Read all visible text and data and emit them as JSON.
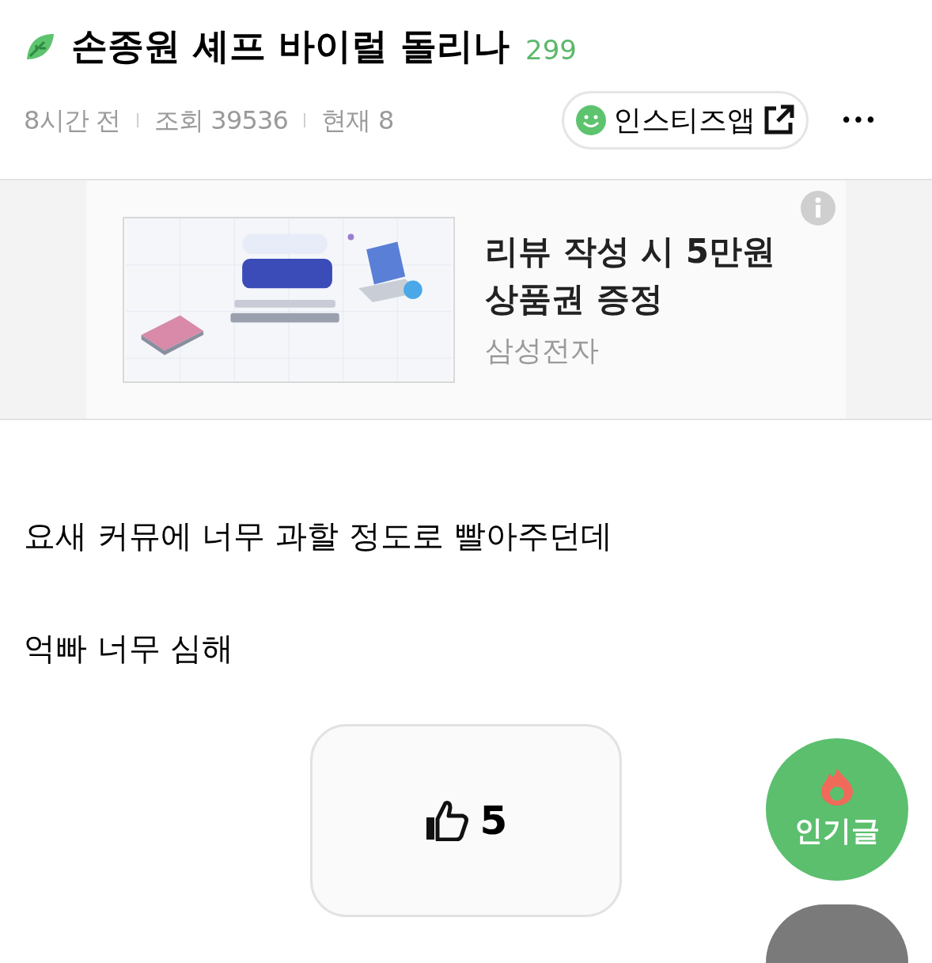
{
  "post": {
    "title": "손종원 셰프 바이럴 돌리나",
    "comment_count": "299",
    "meta": [
      "8시간 전",
      "조회 39536",
      "현재 8"
    ],
    "app_button": "인스티즈앱",
    "more": "•••"
  },
  "ad": {
    "kind": "picture",
    "headline": "리뷰 작성 시 5만원 상품권 증정",
    "advertiser": "삼성전자"
  },
  "body": [
    "요새 커뮤에 너무 과할 정도로 빨아주던데",
    "억빠 너무 심해"
  ],
  "like": {
    "count": "5"
  },
  "floating": {
    "popular": "인기글"
  }
}
